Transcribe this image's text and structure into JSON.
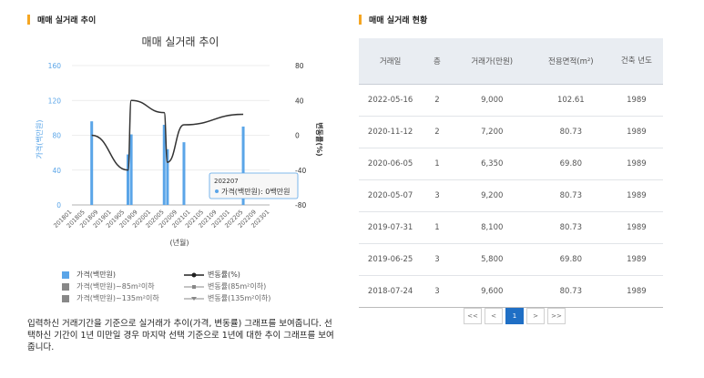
{
  "left_section": {
    "title": "매매 실거래 추이"
  },
  "right_section": {
    "title": "매매 실거래 현황"
  },
  "chart_data": {
    "type": "bar",
    "title": "매매 실거래 추이",
    "xlabel": "(년월)",
    "ylabel": "가격(백만원)",
    "y2label": "변동률(%)",
    "ylim": [
      0,
      160
    ],
    "y2lim": [
      -80,
      80
    ],
    "yticks": [
      "0",
      "40",
      "80",
      "120",
      "160"
    ],
    "y2ticks": [
      "-80",
      "-40",
      "0",
      "40",
      "80"
    ],
    "x_ticks": [
      "201801",
      "201805",
      "201809",
      "201901",
      "201905",
      "201909",
      "202001",
      "202005",
      "202009",
      "202101",
      "202105",
      "202109",
      "202201",
      "202205",
      "202209",
      "202301"
    ],
    "series": [
      {
        "name": "가격(백만원)",
        "type": "bar",
        "color": "#5aa5e8",
        "points": [
          {
            "x": "201807",
            "y": 96
          },
          {
            "x": "201906",
            "y": 58
          },
          {
            "x": "201907",
            "y": 81
          },
          {
            "x": "202005",
            "y": 92
          },
          {
            "x": "202006",
            "y": 64
          },
          {
            "x": "202011",
            "y": 72
          },
          {
            "x": "202205",
            "y": 90
          }
        ]
      },
      {
        "name": "변동률(%)",
        "type": "line",
        "color": "#333333",
        "points": [
          {
            "x": "201807",
            "y": 0
          },
          {
            "x": "201906",
            "y": -40
          },
          {
            "x": "201907",
            "y": 40
          },
          {
            "x": "202005",
            "y": 26
          },
          {
            "x": "202006",
            "y": -31
          },
          {
            "x": "202011",
            "y": 12
          },
          {
            "x": "202205",
            "y": 24
          }
        ]
      }
    ],
    "tooltip": {
      "period": "202207",
      "label": "가격(백만원): 0백만원"
    }
  },
  "legend": {
    "price": "가격(백만원)",
    "rate": "변동률(%)",
    "price_85": "가격(백만원)~85m²이하",
    "rate_85": "변동률(85m²이하)",
    "price_135": "가격(백만원)~135m²이하",
    "rate_135": "변동률(135m²이하)"
  },
  "description": "입력하신 거래기간을 기준으로 실거래가 추이(가격, 변동률) 그래프를 보여줍니다. 선택하신 기간이 1년 미만일 경우 마지막 선택 기준으로 1년에 대한 추이 그래프를 보여줍니다.",
  "table": {
    "headers": [
      "거래일",
      "층",
      "거래가(만원)",
      "전용면적(m²)",
      "건축 년도"
    ],
    "rows": [
      [
        "2022-05-16",
        "2",
        "9,000",
        "102.61",
        "1989"
      ],
      [
        "2020-11-12",
        "2",
        "7,200",
        "80.73",
        "1989"
      ],
      [
        "2020-06-05",
        "1",
        "6,350",
        "69.80",
        "1989"
      ],
      [
        "2020-05-07",
        "3",
        "9,200",
        "80.73",
        "1989"
      ],
      [
        "2019-07-31",
        "1",
        "8,100",
        "80.73",
        "1989"
      ],
      [
        "2019-06-25",
        "3",
        "5,800",
        "69.80",
        "1989"
      ],
      [
        "2018-07-24",
        "3",
        "9,600",
        "80.73",
        "1989"
      ]
    ]
  },
  "pagination": {
    "first": "<<",
    "prev": "<",
    "current": "1",
    "next": ">",
    "last": ">>"
  }
}
